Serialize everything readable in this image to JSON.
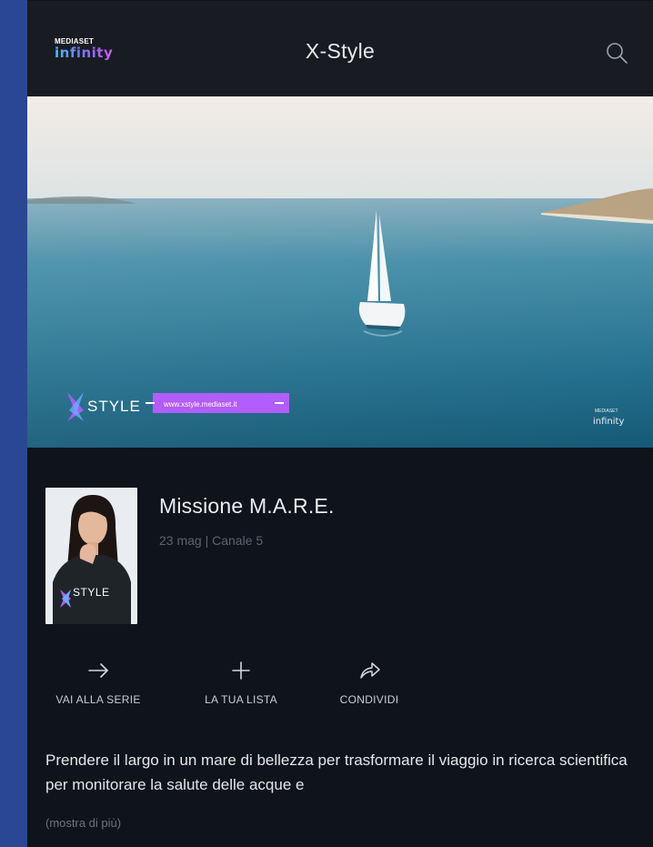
{
  "brand": {
    "top": "MEDIASET",
    "bottom": "infinity"
  },
  "header": {
    "title": "X-Style"
  },
  "hero": {
    "overlay_logo": "STYLE",
    "overlay_url": "www.xstyle.mediaset.it",
    "watermark_top": "MEDIASET",
    "watermark_bottom": "infinity"
  },
  "episode": {
    "title": "Missione M.A.R.E.",
    "meta": "23 mag | Canale 5",
    "thumb_label": "STYLE"
  },
  "actions": [
    {
      "label": "VAI ALLA SERIE",
      "icon": "arrow-right-icon"
    },
    {
      "label": "LA TUA LISTA",
      "icon": "plus-icon"
    },
    {
      "label": "CONDIVIDI",
      "icon": "share-icon"
    }
  ],
  "description": "Prendere il largo in un mare di bellezza per trasformare il viaggio in ricerca scientifica per monitorare la salute delle acque e",
  "more_label": "(mostra di più)",
  "colors": {
    "background": "#0f131b",
    "header": "#181b21",
    "frame": "#2a4796",
    "accent": "#b35cff"
  }
}
